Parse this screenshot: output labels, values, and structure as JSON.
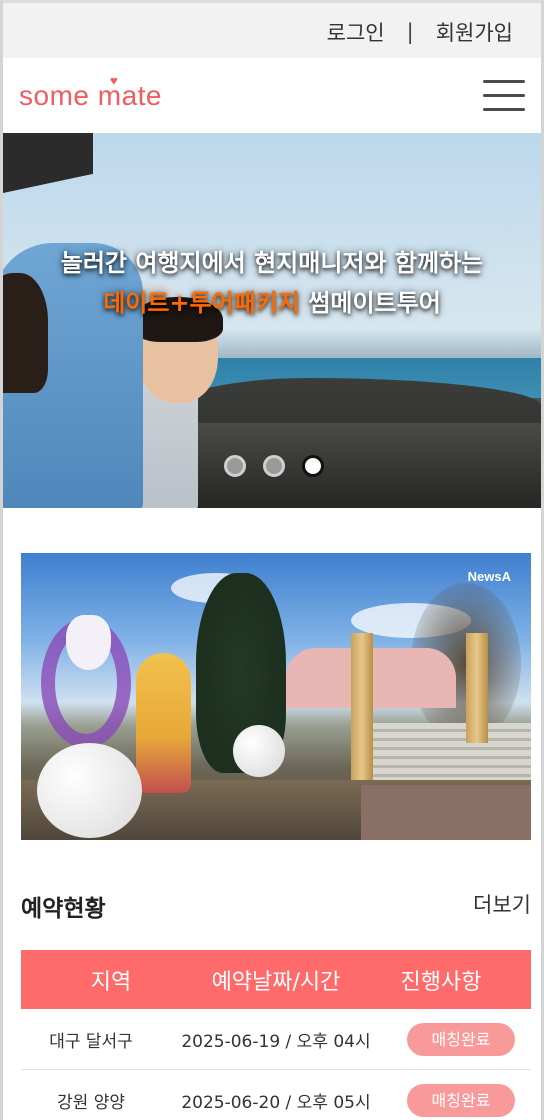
{
  "topbar": {
    "login_label": "로그인",
    "separator": "|",
    "signup_label": "회원가입"
  },
  "header": {
    "logo_text": "some mate",
    "menu_icon": "hamburger-menu-icon"
  },
  "hero": {
    "line1": "놀러간 여행지에서 현지매니저와 함께하는",
    "line2_highlight": "데이트+투어패키지",
    "line2_rest": " 썸메이트투어",
    "slides": 3,
    "active_slide": 3,
    "highlight_color": "#ff6a00"
  },
  "promo": {
    "watermark": "NewsA"
  },
  "reservations": {
    "title": "예약현황",
    "more_label": "더보기",
    "columns": [
      "지역",
      "예약날짜/시간",
      "진행사항"
    ],
    "rows": [
      {
        "region": "대구 달서구",
        "datetime": "2025-06-19 / 오후 04시",
        "status": "매칭완료"
      },
      {
        "region": "강원 양양",
        "datetime": "2025-06-20 / 오후 05시",
        "status": "매칭완료"
      }
    ]
  },
  "colors": {
    "brand": "#f25c5c",
    "table_header": "#ff6b6b",
    "badge": "#f99a9a"
  }
}
